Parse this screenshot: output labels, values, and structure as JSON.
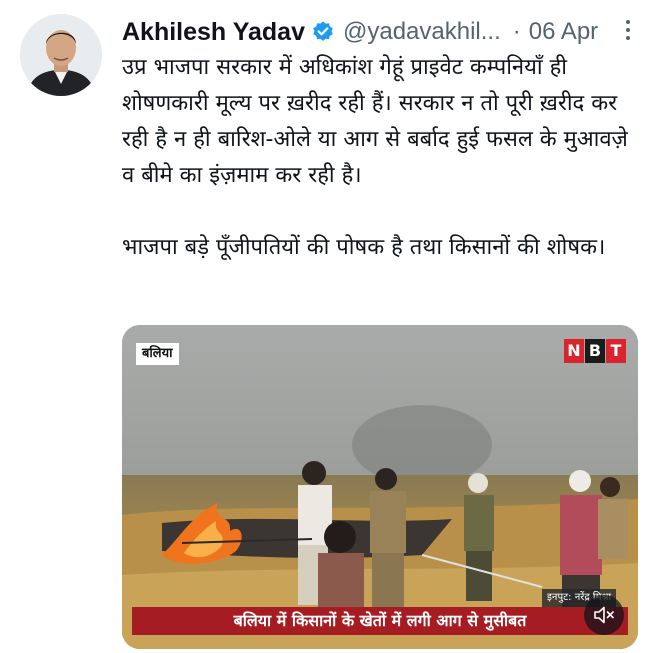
{
  "tweet": {
    "author_name": "Akhilesh Yadav",
    "handle": "@yadavakhil...",
    "separator": "·",
    "date": "06 Apr",
    "verified_color": "#1d9bf0",
    "paragraphs": [
      "उप्र भाजपा सरकार में अधिकांश गेहूं प्राइवेट कम्पनियाँ ही शोषणकारी मूल्य पर ख़रीद रही हैं। सरकार न तो पूरी ख़रीद कर रही है न ही बारिश-ओले या आग से बर्बाद हुई फसल के मुआवज़े व बीमे का इंज़माम कर रही है।",
      "भाजपा बड़े पूँजीपतियों की पोषक है तथा किसानों की शोषक।"
    ]
  },
  "media": {
    "location_tag": "बलिया",
    "brand": [
      "N",
      "B",
      "T"
    ],
    "input_credit": "इनपुट: नरेंद्र मिश्रा",
    "caption": "बलिया में किसानों के खेतों में लगी आग से मुसीबत",
    "mute_icon": "speaker-muted-icon",
    "fire_color": "#f0731d",
    "caption_bar_color": "#a51c22"
  }
}
